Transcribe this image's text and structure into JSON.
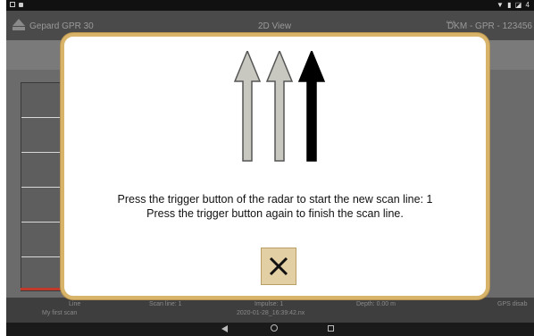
{
  "status_bar": {
    "right_icons": "▼ ▮ ◪ 4"
  },
  "app_bar": {
    "title": "Gepard GPR 30",
    "view_label": "2D View",
    "right_text": "DKM - GPR - 123456",
    "right_icon_text": "°°°"
  },
  "bottom_info": {
    "line_label": "Line",
    "line_name": "My first scan",
    "scan_line": "Scan line: 1",
    "impulse": "Impulse: 1",
    "timestamp": "2020-01-28_16:39:42.nx",
    "depth": "Depth: 0.00 m",
    "gps": "GPS disab"
  },
  "dialog": {
    "message_line1": "Press the trigger button of the radar to start the new scan line: 1",
    "message_line2": "Press the trigger button again to finish the scan line.",
    "close_symbol": "✕",
    "arrow_colors": [
      "#c8c8c0",
      "#c8c8c0",
      "#000000"
    ]
  }
}
